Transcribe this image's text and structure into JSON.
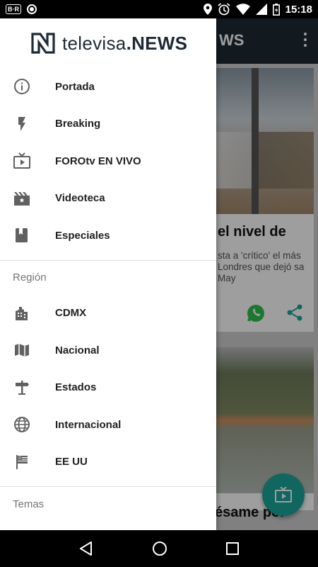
{
  "status_bar": {
    "time": "15:18",
    "left_badge": "B·R"
  },
  "background_app": {
    "title_fragment": "WS",
    "card1": {
      "headline": "el nivel de",
      "snippet": "sta a 'crítico' el más Londres que dejó sa May"
    },
    "card2": {
      "headline": "ésame por"
    },
    "accent_color": "#1aa79a"
  },
  "drawer": {
    "brand": {
      "name_light": "televisa",
      "name_bold": ".NEWS"
    },
    "main_items": [
      {
        "label": "Portada",
        "icon": "info-icon"
      },
      {
        "label": "Breaking",
        "icon": "lightning-icon"
      },
      {
        "label": "FOROtv EN VIVO",
        "icon": "tv-icon"
      },
      {
        "label": "Videoteca",
        "icon": "video-library-icon"
      },
      {
        "label": "Especiales",
        "icon": "book-icon"
      }
    ],
    "region_title": "Región",
    "region_items": [
      {
        "label": "CDMX",
        "icon": "city-icon"
      },
      {
        "label": "Nacional",
        "icon": "map-icon"
      },
      {
        "label": "Estados",
        "icon": "signpost-icon"
      },
      {
        "label": "Internacional",
        "icon": "globe-icon"
      },
      {
        "label": "EE UU",
        "icon": "flag-icon"
      }
    ],
    "topics_title": "Temas"
  }
}
